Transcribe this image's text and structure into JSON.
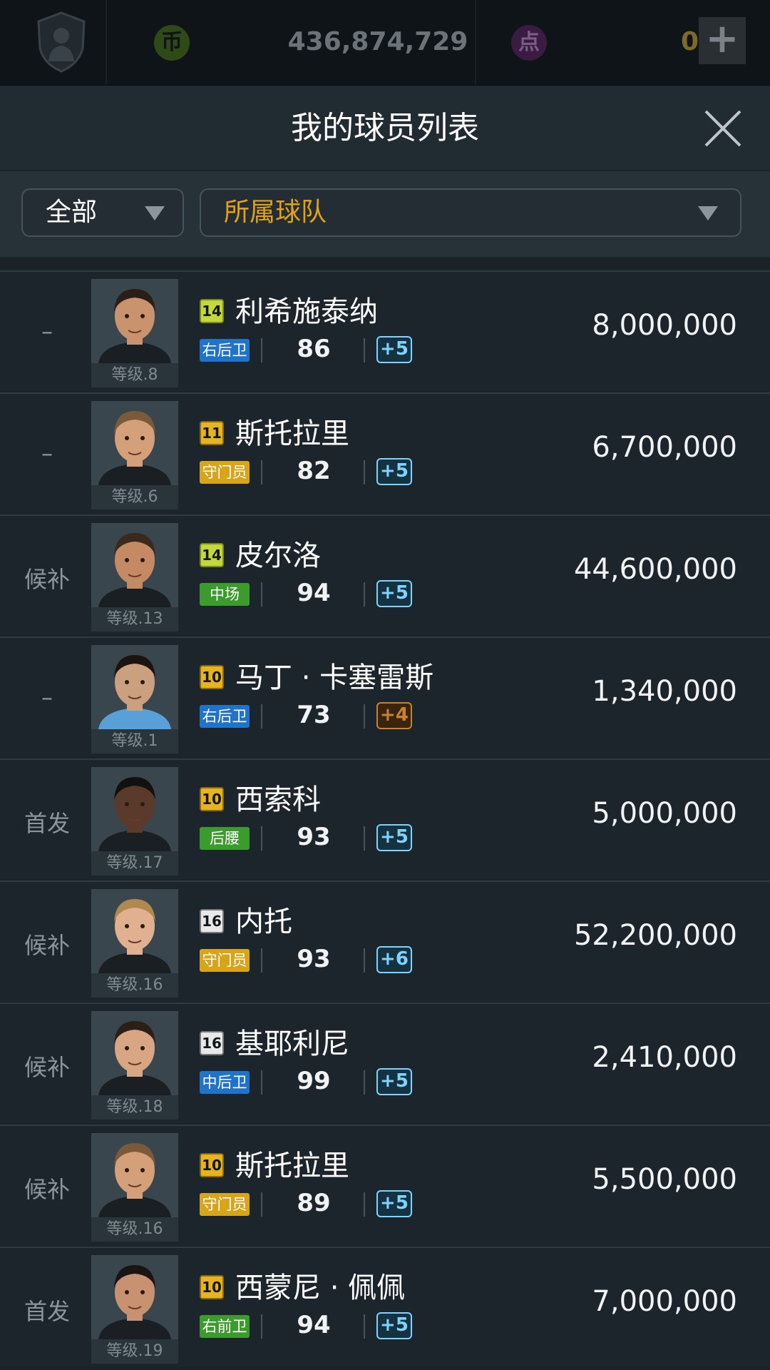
{
  "topbar": {
    "coin_icon_label": "币",
    "coins": "436,874,729",
    "point_icon_label": "点",
    "points": "0",
    "add_label": "+"
  },
  "header": {
    "title": "我的球员列表"
  },
  "filters": {
    "category": "全部",
    "team": "所属球队"
  },
  "colors": {
    "position_blue": "#1f73c9",
    "position_yellow": "#d7a51b",
    "position_green": "#3b9b2c",
    "badge_green": "#c3d93b",
    "badge_gold": "#e7b31f",
    "badge_white": "#e8e8e8"
  },
  "players": [
    {
      "status": "–",
      "level": "等级.8",
      "badge": "14",
      "badge_color": "green",
      "name": "利希施泰纳",
      "position": "右后卫",
      "position_color": "blue",
      "ovr": "86",
      "boost": "+5",
      "boost_color": "blue",
      "price": "8,000,000"
    },
    {
      "status": "–",
      "level": "等级.6",
      "badge": "11",
      "badge_color": "gold",
      "name": "斯托拉里",
      "position": "守门员",
      "position_color": "yellow",
      "ovr": "82",
      "boost": "+5",
      "boost_color": "blue",
      "price": "6,700,000"
    },
    {
      "status": "候补",
      "level": "等级.13",
      "badge": "14",
      "badge_color": "green",
      "name": "皮尔洛",
      "position": "中场",
      "position_color": "green",
      "ovr": "94",
      "boost": "+5",
      "boost_color": "blue",
      "price": "44,600,000"
    },
    {
      "status": "–",
      "level": "等级.1",
      "badge": "10",
      "badge_color": "gold",
      "name": "马丁 · 卡塞雷斯",
      "position": "右后卫",
      "position_color": "blue",
      "ovr": "73",
      "boost": "+4",
      "boost_color": "orange",
      "price": "1,340,000"
    },
    {
      "status": "首发",
      "level": "等级.17",
      "badge": "10",
      "badge_color": "gold",
      "name": "西索科",
      "position": "后腰",
      "position_color": "green",
      "ovr": "93",
      "boost": "+5",
      "boost_color": "blue",
      "price": "5,000,000"
    },
    {
      "status": "候补",
      "level": "等级.16",
      "badge": "16",
      "badge_color": "white",
      "name": "内托",
      "position": "守门员",
      "position_color": "yellow",
      "ovr": "93",
      "boost": "+6",
      "boost_color": "blue",
      "price": "52,200,000"
    },
    {
      "status": "候补",
      "level": "等级.18",
      "badge": "16",
      "badge_color": "white",
      "name": "基耶利尼",
      "position": "中后卫",
      "position_color": "blue",
      "ovr": "99",
      "boost": "+5",
      "boost_color": "blue",
      "price": "2,410,000"
    },
    {
      "status": "候补",
      "level": "等级.16",
      "badge": "10",
      "badge_color": "gold",
      "name": "斯托拉里",
      "position": "守门员",
      "position_color": "yellow",
      "ovr": "89",
      "boost": "+5",
      "boost_color": "blue",
      "price": "5,500,000"
    },
    {
      "status": "首发",
      "level": "等级.19",
      "badge": "10",
      "badge_color": "gold",
      "name": "西蒙尼 · 佩佩",
      "position": "右前卫",
      "position_color": "green",
      "ovr": "94",
      "boost": "+5",
      "boost_color": "blue",
      "price": "7,000,000"
    }
  ]
}
